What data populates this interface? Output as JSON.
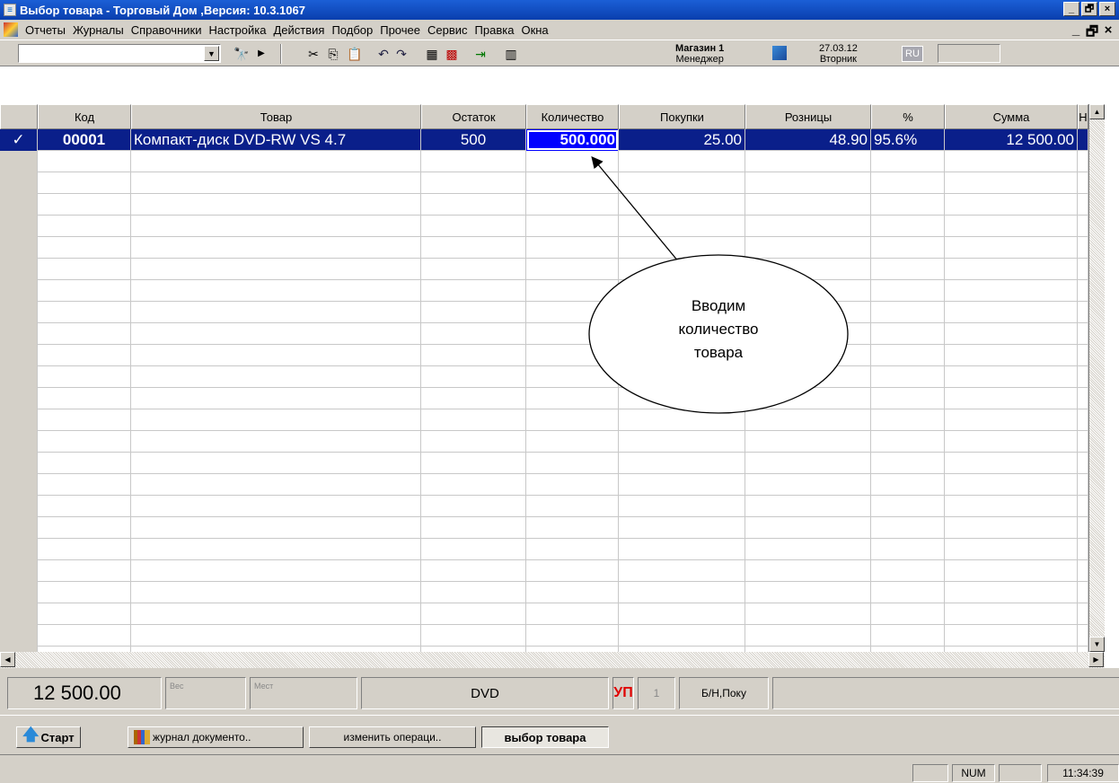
{
  "window": {
    "title": "Выбор товара - Торговый Дом ,Версия: 10.3.1067",
    "buttons": [
      "_",
      "🗗",
      "×"
    ]
  },
  "menu": {
    "items": [
      "Отчеты",
      "Журналы",
      "Справочники",
      "Настройка",
      "Действия",
      "Подбор",
      "Прочее",
      "Сервис",
      "Правка",
      "Окна"
    ],
    "mdi_buttons": [
      "_",
      "🗗",
      "×"
    ]
  },
  "toolbar": {
    "search_value": "",
    "shop_name": "Магазин 1",
    "role": "Менеджер",
    "date": "27.03.12",
    "weekday": "Вторник",
    "lang": "RU",
    "icons": [
      "binoculars-icon",
      "play-icon",
      "cut-icon",
      "copy-icon",
      "paste-icon",
      "undo-icon",
      "redo-icon",
      "calculator-icon",
      "barcode-grid-icon",
      "exit-icon",
      "keypad-icon",
      "monitor-icon"
    ]
  },
  "grid": {
    "columns": [
      "Код",
      "Товар",
      "Остаток",
      "Количество",
      "Покупки",
      "Розницы",
      "%",
      "Сумма",
      "Н"
    ],
    "rows": [
      {
        "check": "✓",
        "code": "00001",
        "product": "Компакт-диск DVD-RW VS 4.7",
        "stock": "500",
        "quantity": "500.000",
        "purchase": "25.00",
        "retail": "48.90",
        "percent": "95.6%",
        "sum": "12 500.00"
      }
    ]
  },
  "annotation": {
    "text_lines": [
      "Вводим",
      "количество",
      "товара"
    ]
  },
  "status": {
    "total": "12 500.00",
    "weight_label": "Вес",
    "places_label": "Мест",
    "group": "DVD",
    "up": "УП",
    "count": "1",
    "payment": "Б/Н,Поку"
  },
  "taskbar": {
    "start": "Старт",
    "items": [
      "журнал документо..",
      "изменить операци..",
      "выбор товара"
    ]
  },
  "bottom": {
    "num": "NUM",
    "time": "11:34:39"
  }
}
